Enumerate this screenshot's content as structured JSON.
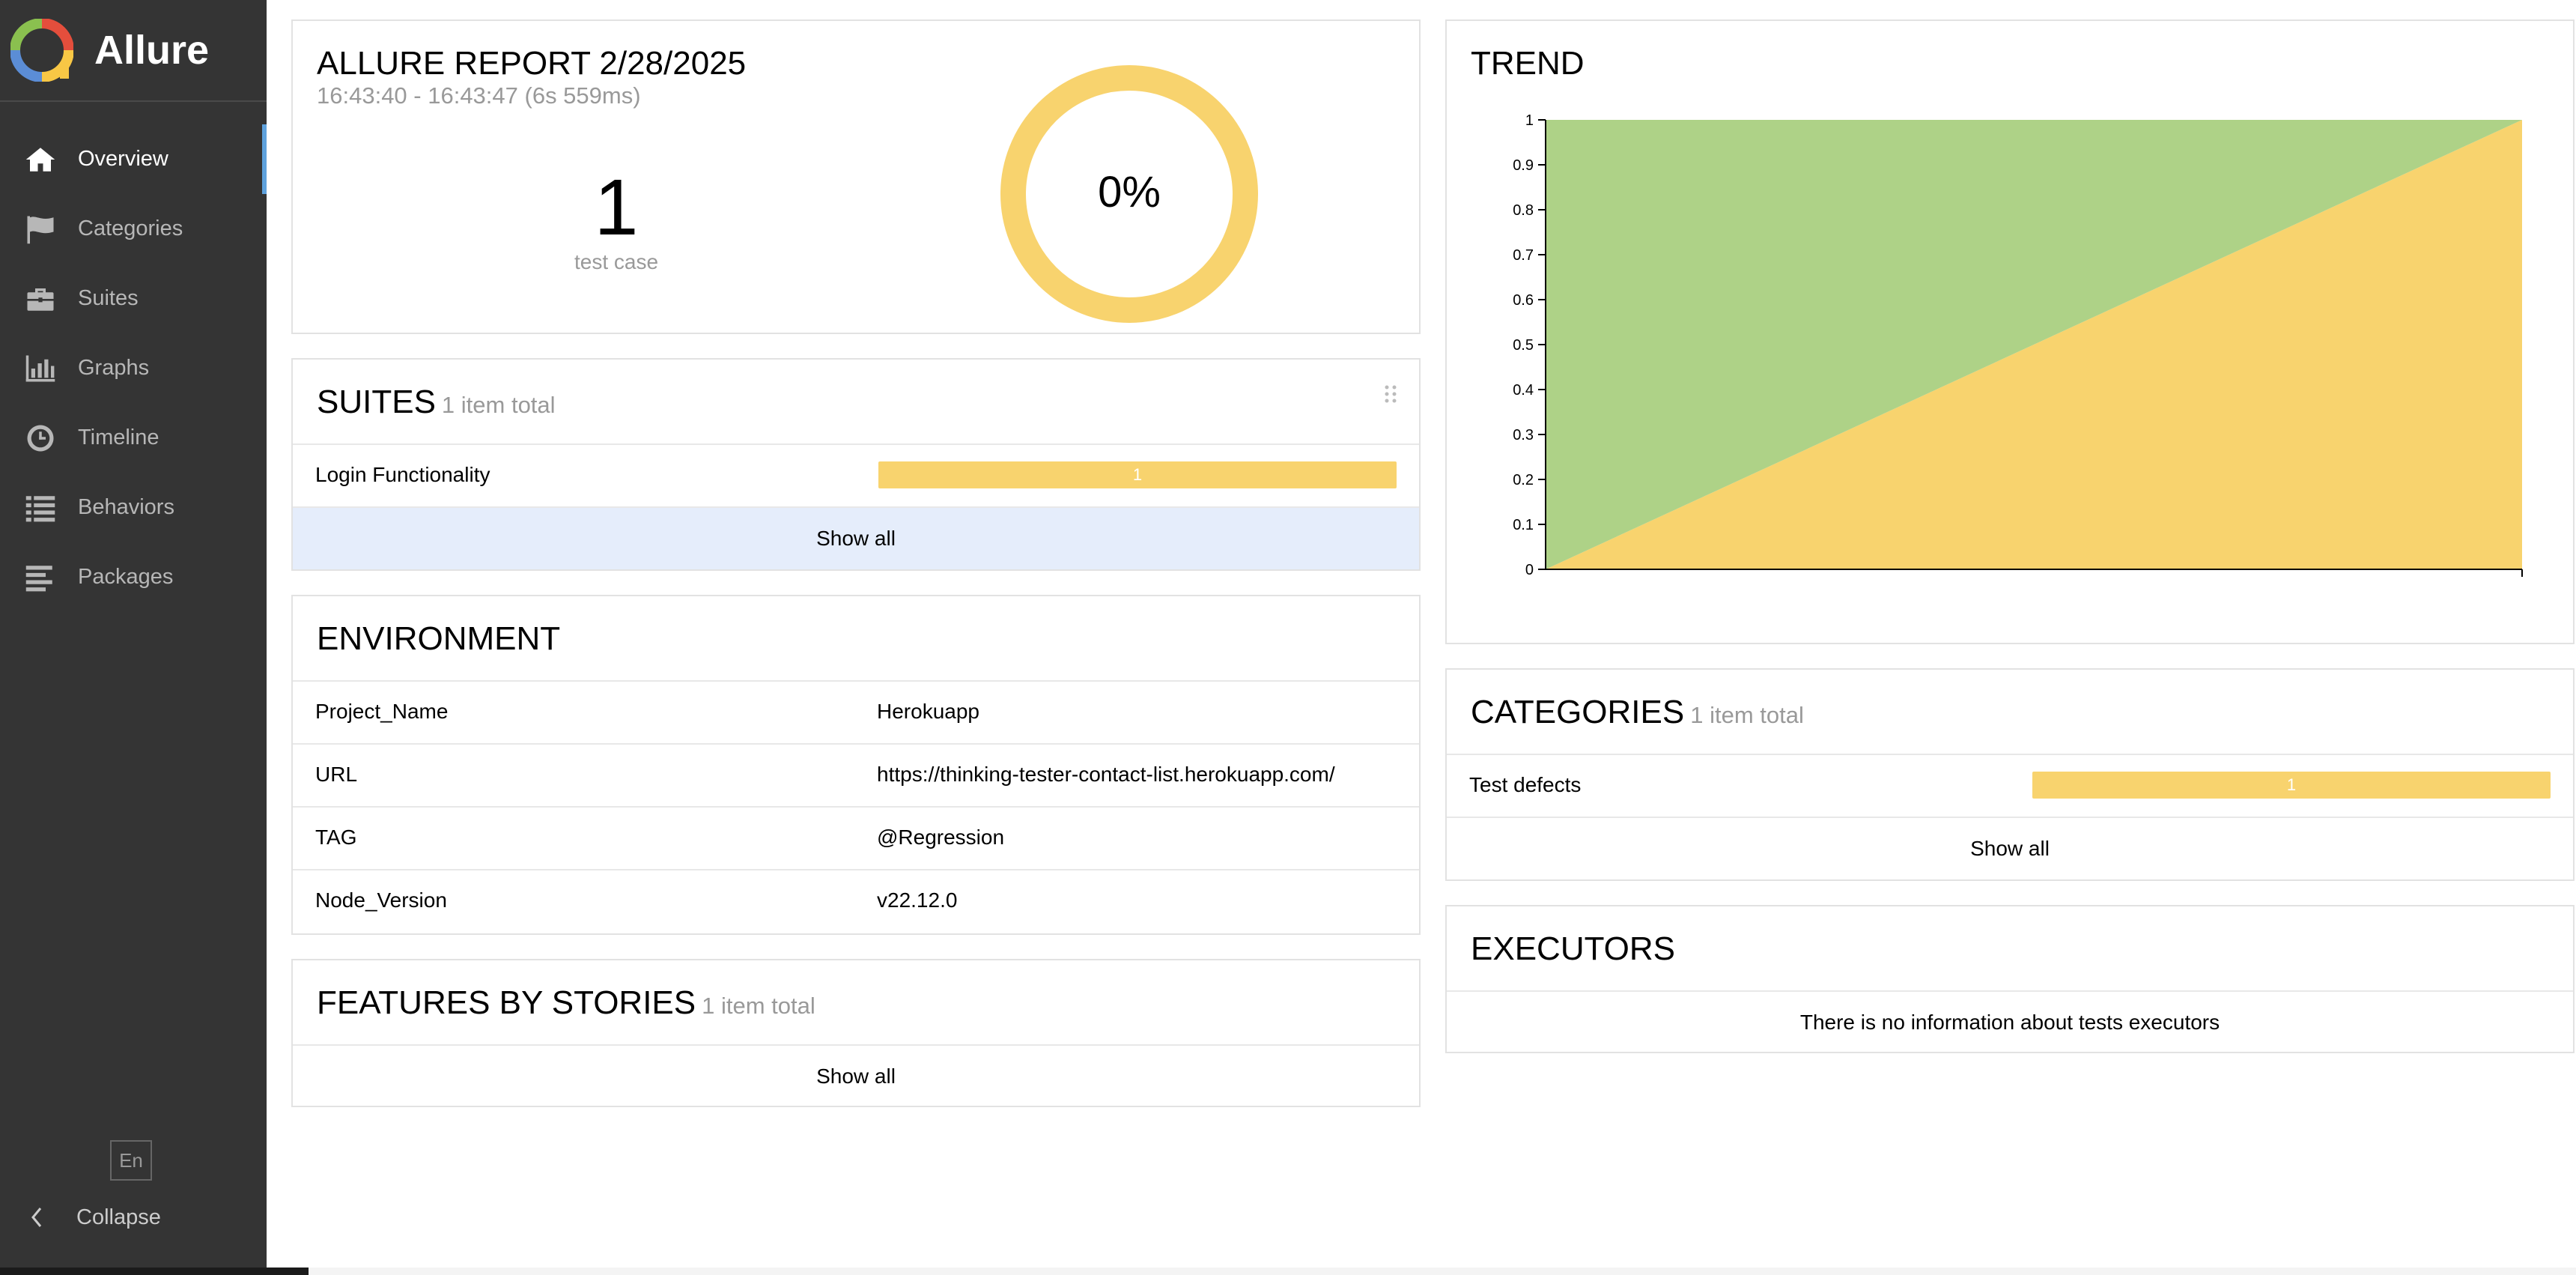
{
  "app": {
    "name": "Allure"
  },
  "sidebar": {
    "items": [
      {
        "label": "Overview",
        "icon": "home-icon",
        "active": true
      },
      {
        "label": "Categories",
        "icon": "flag-icon"
      },
      {
        "label": "Suites",
        "icon": "briefcase-icon"
      },
      {
        "label": "Graphs",
        "icon": "bar-chart-icon"
      },
      {
        "label": "Timeline",
        "icon": "clock-icon"
      },
      {
        "label": "Behaviors",
        "icon": "list-icon"
      },
      {
        "label": "Packages",
        "icon": "align-left-icon"
      }
    ],
    "language": "En",
    "collapse_label": "Collapse"
  },
  "summary": {
    "title": "ALLURE REPORT 2/28/2025",
    "time_range": "16:43:40 - 16:43:47 (6s 559ms)",
    "test_count": "1",
    "test_label": "test case",
    "percent": "0%",
    "percent_value": 0,
    "ring_color": "#f8d36e"
  },
  "suites": {
    "title": "SUITES",
    "count": "1 item total",
    "items": [
      {
        "name": "Login Functionality",
        "value": "1"
      }
    ],
    "show_all": "Show all"
  },
  "environment": {
    "title": "ENVIRONMENT",
    "rows": [
      {
        "key": "Project_Name",
        "value": "Herokuapp"
      },
      {
        "key": "URL",
        "value": "https://thinking-tester-contact-list.herokuapp.com/"
      },
      {
        "key": "TAG",
        "value": "@Regression"
      },
      {
        "key": "Node_Version",
        "value": "v22.12.0"
      }
    ]
  },
  "features": {
    "title": "FEATURES BY STORIES",
    "count": "1 item total",
    "show_all": "Show all"
  },
  "trend": {
    "title": "TREND"
  },
  "chart_data": {
    "type": "area",
    "x": [
      0,
      1
    ],
    "series": [
      {
        "name": "",
        "color": "#f8d36e",
        "values": [
          0,
          1
        ]
      },
      {
        "name": "",
        "color": "#aed287",
        "values": [
          1,
          1
        ]
      }
    ],
    "ylim": [
      0,
      1
    ],
    "yticks": [
      "0",
      "0.1",
      "0.2",
      "0.3",
      "0.4",
      "0.5",
      "0.6",
      "0.7",
      "0.8",
      "0.9",
      "1"
    ],
    "grid": false,
    "title": "",
    "xlabel": "",
    "ylabel": ""
  },
  "categories": {
    "title": "CATEGORIES",
    "count": "1 item total",
    "items": [
      {
        "name": "Test defects",
        "value": "1"
      }
    ],
    "show_all": "Show all"
  },
  "executors": {
    "title": "EXECUTORS",
    "empty_message": "There is no information about tests executors"
  },
  "colors": {
    "sidebar_bg": "#343434",
    "active_accent": "#5fa2dd",
    "broken": "#f8d36e",
    "passed_area": "#aed287",
    "show_all_hover": "#e5edfb"
  }
}
